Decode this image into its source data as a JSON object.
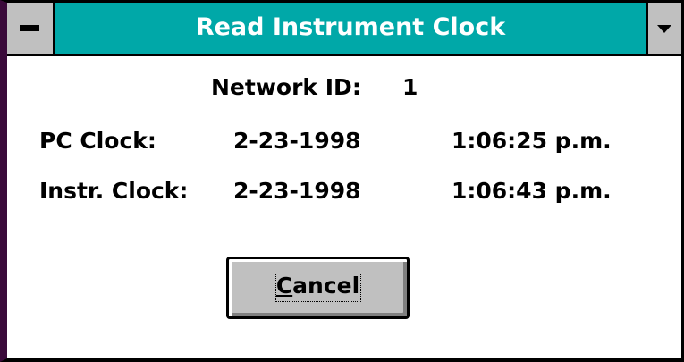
{
  "window": {
    "title": "Read Instrument Clock"
  },
  "network": {
    "label": "Network ID:",
    "value": "1"
  },
  "pc_clock": {
    "label": "PC Clock:",
    "date": "2-23-1998",
    "time": "1:06:25 p.m."
  },
  "instr_clock": {
    "label": "Instr. Clock:",
    "date": "2-23-1998",
    "time": "1:06:43 p.m."
  },
  "buttons": {
    "cancel_label": "Cancel"
  },
  "colors": {
    "titlebar": "#00a8a8",
    "button_face": "#c0c0c0",
    "window_bg": "#ffffff"
  },
  "icons": {
    "system_menu": "system-menu-icon",
    "minimize": "minimize-arrow-icon"
  }
}
